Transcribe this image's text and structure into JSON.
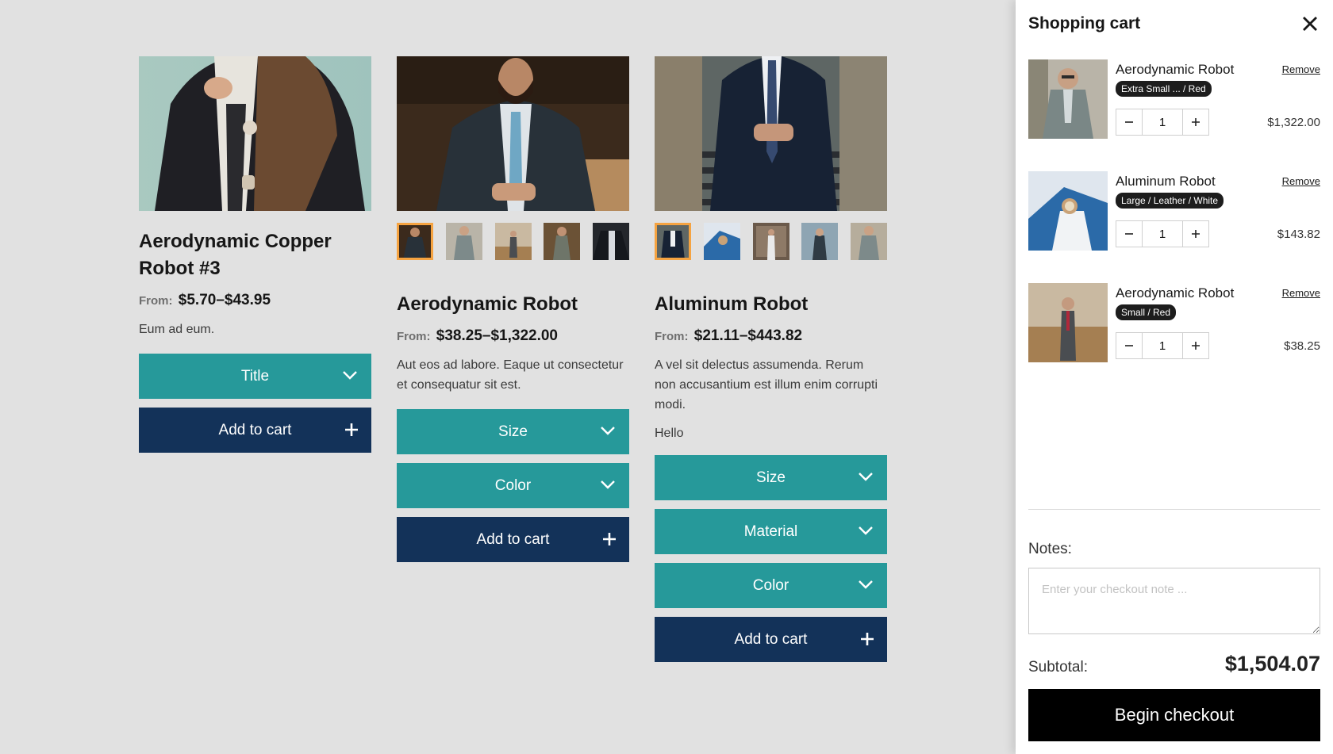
{
  "products": [
    {
      "title": "Aerodynamic Copper Robot #3",
      "from_label": "From:",
      "price": "$5.70–$43.95",
      "description": "Eum ad eum.",
      "selects": [
        "Title"
      ],
      "add_label": "Add to cart"
    },
    {
      "title": "Aerodynamic Robot",
      "from_label": "From:",
      "price": "$38.25–$1,322.00",
      "description": "Aut eos ad labore. Eaque ut consectetur et consequatur sit est.",
      "selects": [
        "Size",
        "Color"
      ],
      "add_label": "Add to cart"
    },
    {
      "title": "Aluminum Robot",
      "from_label": "From:",
      "price": "$21.11–$443.82",
      "description": "A vel sit delectus assumenda. Rerum non accusantium est illum enim corrupti modi.",
      "note": "Hello",
      "selects": [
        "Size",
        "Material",
        "Color"
      ],
      "add_label": "Add to cart"
    }
  ],
  "cart": {
    "title": "Shopping cart",
    "items": [
      {
        "name": "Aerodynamic Robot",
        "variant": "Extra Small ... / Red",
        "qty": "1",
        "price": "$1,322.00",
        "remove": "Remove"
      },
      {
        "name": "Aluminum Robot",
        "variant": "Large / Leather / White",
        "qty": "1",
        "price": "$143.82",
        "remove": "Remove"
      },
      {
        "name": "Aerodynamic Robot",
        "variant": "Small / Red",
        "qty": "1",
        "price": "$38.25",
        "remove": "Remove"
      }
    ],
    "notes_label": "Notes:",
    "notes_placeholder": "Enter your checkout note ...",
    "subtotal_label": "Subtotal:",
    "subtotal": "$1,504.07",
    "checkout_label": "Begin checkout"
  },
  "colors": {
    "select_bg": "#26999a",
    "add_bg": "#133259",
    "thumb_active": "#f5a341"
  },
  "icons": [
    "chevron-down-icon",
    "plus-icon",
    "close-icon",
    "minus-icon"
  ]
}
